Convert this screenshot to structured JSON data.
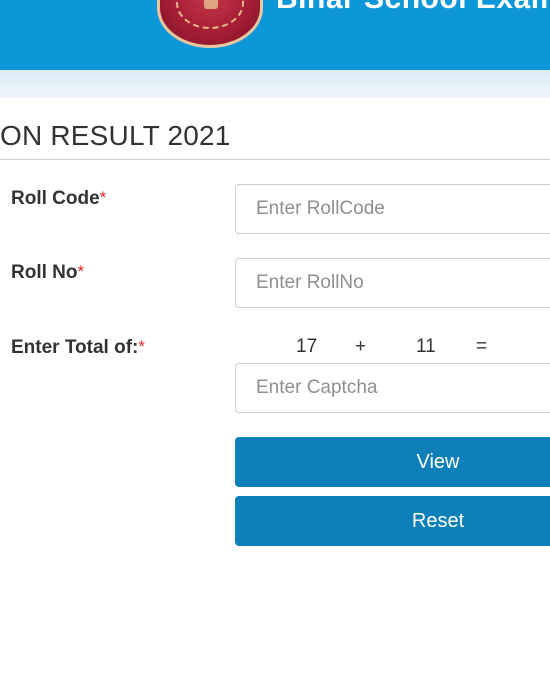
{
  "header": {
    "title": "Bihar School Exami"
  },
  "page": {
    "title": "ON RESULT 2021"
  },
  "form": {
    "roll_code": {
      "label": "Roll Code",
      "required_mark": "*",
      "placeholder": "Enter RollCode",
      "value": ""
    },
    "roll_no": {
      "label": "Roll No",
      "required_mark": "*",
      "placeholder": "Enter RollNo",
      "value": ""
    },
    "captcha": {
      "label": "Enter Total of:",
      "required_mark": "*",
      "num1": "17",
      "operator": "+",
      "num2": "11",
      "equals": "=",
      "placeholder": "Enter Captcha",
      "value": ""
    },
    "view_label": "View",
    "reset_label": "Reset"
  },
  "colors": {
    "header_bg": "#0d97d9",
    "button_bg": "#0e80b9",
    "required": "#e0262b"
  },
  "icons": {
    "logo": "bseb-emblem-logo"
  }
}
